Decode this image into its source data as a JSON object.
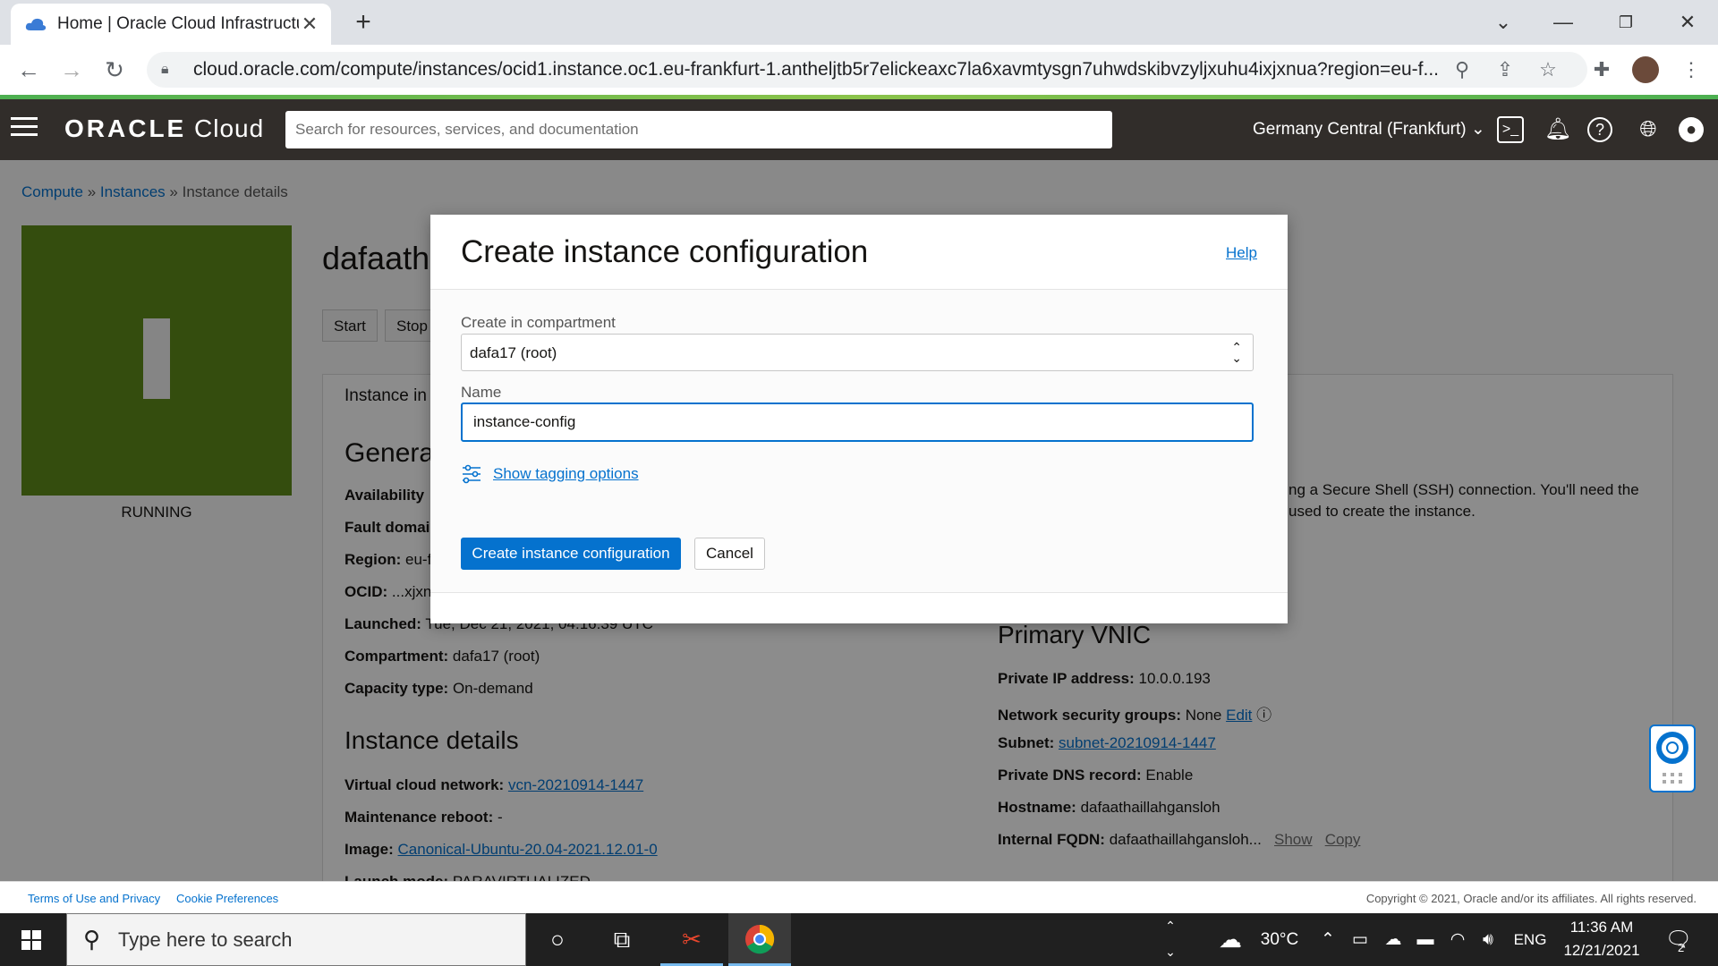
{
  "browser": {
    "tab_title": "Home | Oracle Cloud Infrastructu",
    "url": "cloud.oracle.com/compute/instances/ocid1.instance.oc1.eu-frankfurt-1.antheljtb5r7elickeaxc7la6xavmtysgn7uhwdskibvzyljxuhu4ixjxnua?region=eu-f..."
  },
  "header": {
    "logo_brand": "ORACLE",
    "logo_product": "Cloud",
    "search_placeholder": "Search for resources, services, and documentation",
    "region": "Germany Central (Frankfurt)"
  },
  "breadcrumb": {
    "compute": "Compute",
    "instances": "Instances",
    "current": "Instance details",
    "sep": "»"
  },
  "instance": {
    "title": "dafaatha",
    "status": "RUNNING",
    "buttons": [
      "Start",
      "Stop"
    ],
    "tab_label": "Instance in",
    "general_heading": "Genera",
    "fields": {
      "availability_label": "Availability",
      "fault_label": "Fault domai",
      "region_label": "Region:",
      "region_value": "eu-f",
      "ocid_label": "OCID:",
      "ocid_value": "...xjxn",
      "launched_label": "Launched:",
      "launched_value": "Tue, Dec 21, 2021, 04:16:39 UTC",
      "compartment_label": "Compartment:",
      "compartment_value": "dafa17 (root)",
      "capacity_label": "Capacity type:",
      "capacity_value": "On-demand"
    },
    "details_heading": "Instance details",
    "details": {
      "vcn_label": "Virtual cloud network:",
      "vcn_value": "vcn-20210914-1447",
      "maint_label": "Maintenance reboot:",
      "maint_value": "-",
      "image_label": "Image:",
      "image_value": "Canonical-Ubuntu-20.04-2021.12.01-0",
      "launch_label": "Launch mode:",
      "launch_value": "PARAVIRTUALIZED"
    },
    "ssh_text_1": "ng a Secure Shell (SSH) connection. You'll need the",
    "ssh_text_2": "used to create the instance.",
    "vnic_heading": "Primary VNIC",
    "vnic": {
      "private_ip_label": "Private IP address:",
      "private_ip_value": "10.0.0.193",
      "nsg_label": "Network security groups:",
      "nsg_value": "None",
      "nsg_edit": "Edit",
      "subnet_label": "Subnet:",
      "subnet_value": "subnet-20210914-1447",
      "dns_label": "Private DNS record:",
      "dns_value": "Enable",
      "hostname_label": "Hostname:",
      "hostname_value": "dafaathaillahgansloh",
      "fqdn_label": "Internal FQDN:",
      "fqdn_value": "dafaathaillahgansloh...",
      "fqdn_show": "Show",
      "fqdn_copy": "Copy"
    }
  },
  "modal": {
    "title": "Create instance configuration",
    "help": "Help",
    "compartment_label": "Create in compartment",
    "compartment_value": "dafa17 (root)",
    "name_label": "Name",
    "name_value": "instance-config",
    "tagging_link": "Show tagging options",
    "create_button": "Create instance configuration",
    "cancel_button": "Cancel"
  },
  "footer": {
    "terms": "Terms of Use and Privacy",
    "cookies": "Cookie Preferences",
    "copyright": "Copyright © 2021, Oracle and/or its affiliates. All rights reserved."
  },
  "taskbar": {
    "search_placeholder": "Type here to search",
    "temperature": "30°C",
    "language": "ENG",
    "time": "11:36 AM",
    "date": "12/21/2021",
    "notifications": "2"
  }
}
